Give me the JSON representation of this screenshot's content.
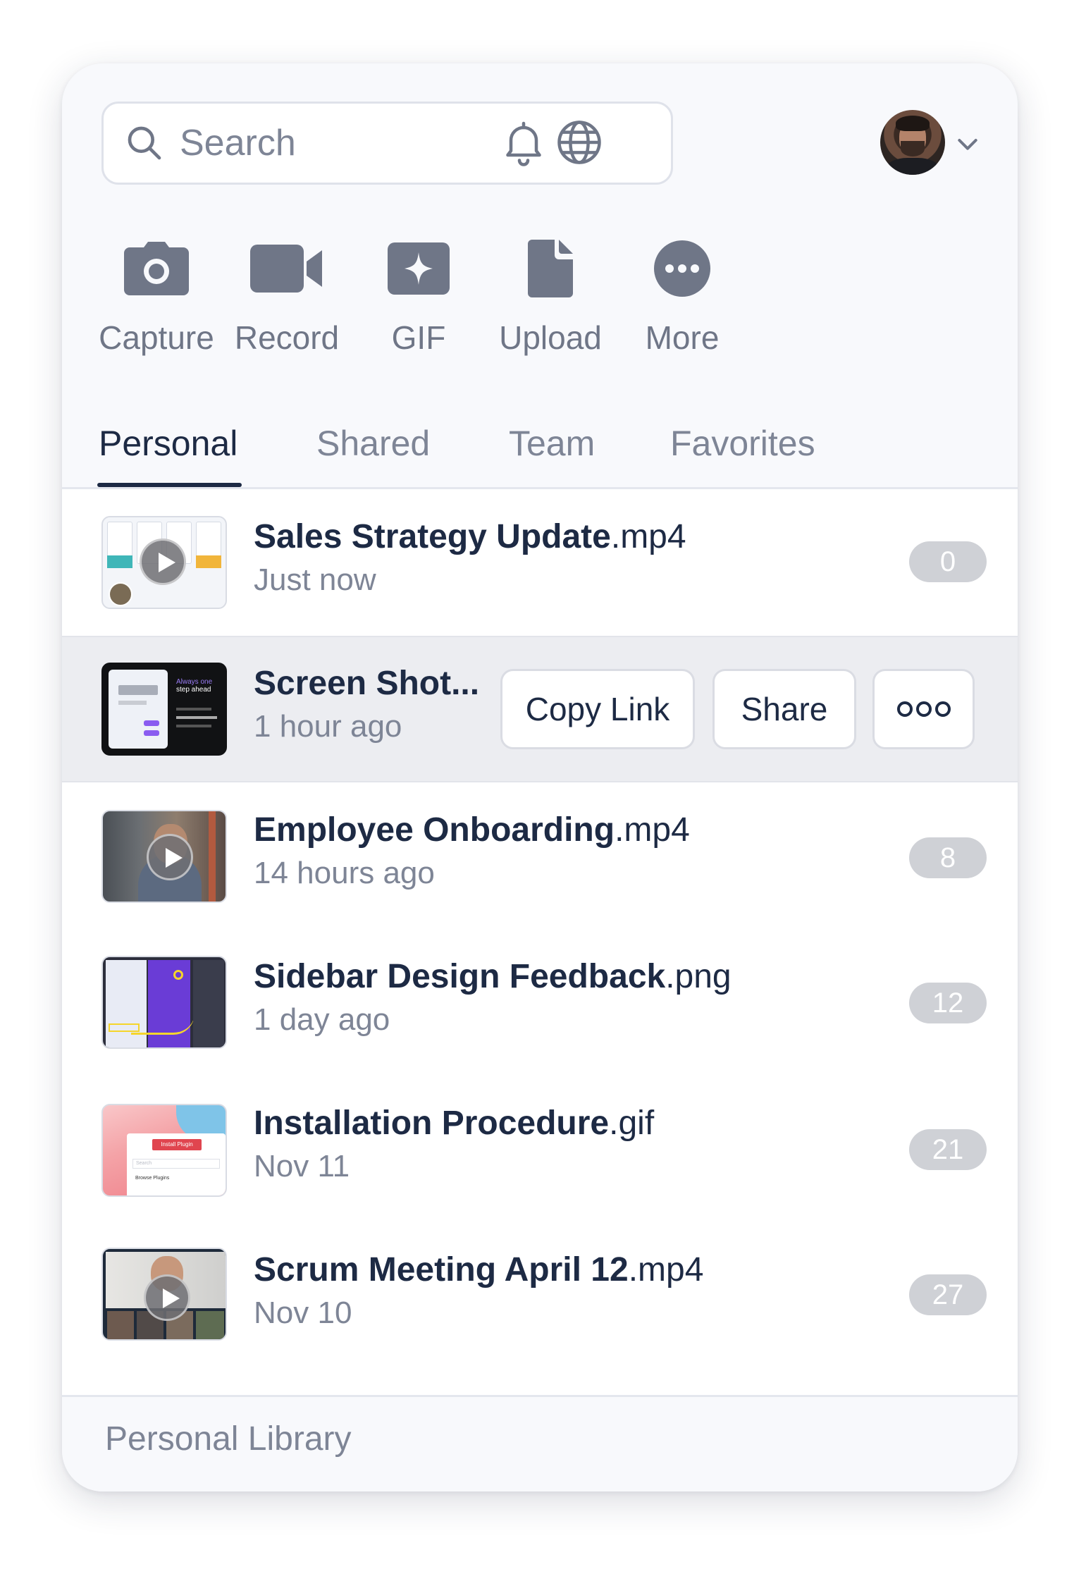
{
  "search": {
    "placeholder": "Search"
  },
  "header": {
    "notifications_icon": "bell-icon",
    "language_icon": "globe-icon",
    "account_icon": "avatar"
  },
  "actions": [
    {
      "label": "Capture",
      "icon": "camera-icon"
    },
    {
      "label": "Record",
      "icon": "video-camera-icon"
    },
    {
      "label": "GIF",
      "icon": "sparkle-icon"
    },
    {
      "label": "Upload",
      "icon": "document-icon"
    },
    {
      "label": "More",
      "icon": "ellipsis-circle-icon"
    }
  ],
  "tabs": [
    {
      "label": "Personal",
      "active": true
    },
    {
      "label": "Shared",
      "active": false
    },
    {
      "label": "Team",
      "active": false
    },
    {
      "label": "Favorites",
      "active": false
    }
  ],
  "files": [
    {
      "name": "Sales Strategy Update",
      "ext": ".mp4",
      "time": "Just now",
      "count": "0"
    },
    {
      "name": "Screen Shot...",
      "ext": "",
      "time": "1 hour ago",
      "count": ""
    },
    {
      "name": "Employee Onboarding",
      "ext": ".mp4",
      "time": "14 hours ago",
      "count": "8"
    },
    {
      "name": "Sidebar Design Feedback",
      "ext": ".png",
      "time": "1 day ago",
      "count": "12"
    },
    {
      "name": "Installation Procedure",
      "ext": ".gif",
      "time": "Nov 11",
      "count": "21"
    },
    {
      "name": "Scrum Meeting April 12",
      "ext": ".mp4",
      "time": "Nov 10",
      "count": "27"
    }
  ],
  "row_actions": {
    "copy_link": "Copy Link",
    "share": "Share",
    "more_icon": "ellipsis-icon"
  },
  "thumb_text": {
    "screenshot_line1": "Always one",
    "screenshot_line2": "step ahead",
    "install_button": "Install Plugin",
    "install_search": "Search",
    "install_browse": "Browse Plugins"
  },
  "footer": {
    "label": "Personal Library"
  },
  "colors": {
    "text": "#1d2a44",
    "muted": "#7e8596",
    "icon": "#6f7687",
    "badge": "#cfd1d6",
    "accent": "#7c5ce0"
  }
}
